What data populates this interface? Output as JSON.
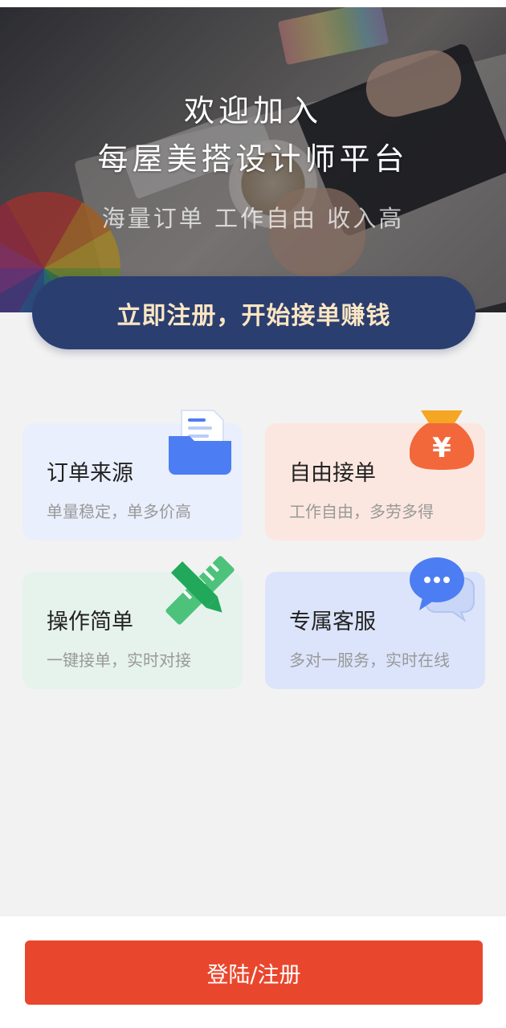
{
  "hero": {
    "title_line1": "欢迎加入",
    "title_line2": "每屋美搭设计师平台",
    "subtitle": "海量订单 工作自由 收入高"
  },
  "cta": {
    "label": "立即注册，开始接单赚钱"
  },
  "features": [
    {
      "title": "订单来源",
      "desc": "单量稳定，单多价高",
      "icon": "folder-document-icon",
      "bg": "#e9effc"
    },
    {
      "title": "自由接单",
      "desc": "工作自由，多劳多得",
      "icon": "yen-money-bag-icon",
      "bg": "#fbe7df"
    },
    {
      "title": "操作简单",
      "desc": "一键接单，实时对接",
      "icon": "pencil-ruler-icon",
      "bg": "#e6f3ec"
    },
    {
      "title": "专属客服",
      "desc": "多对一服务，实时在线",
      "icon": "chat-bubbles-icon",
      "bg": "#dbe4fa"
    }
  ],
  "footer": {
    "login_label": "登陆/注册"
  },
  "colors": {
    "cta_bg": "#2b3e70",
    "cta_text": "#fbe6c2",
    "login_bg": "#e9472d",
    "page_bg": "#f2f2f2"
  }
}
